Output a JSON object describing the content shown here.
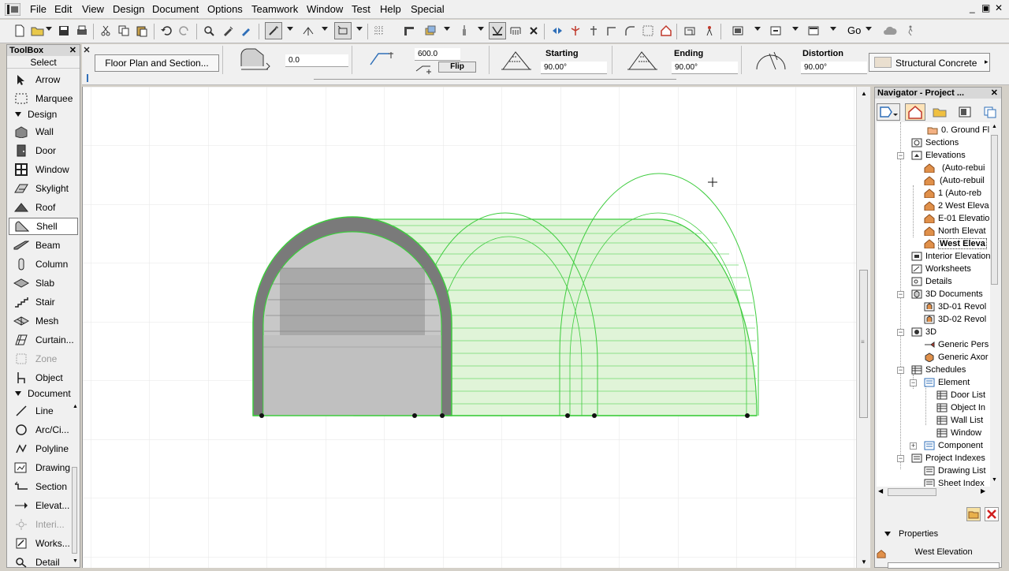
{
  "menubar": {
    "items": [
      "File",
      "Edit",
      "View",
      "Design",
      "Document",
      "Options",
      "Teamwork",
      "Window",
      "Test",
      "Help",
      "Special"
    ],
    "win_controls": [
      "_",
      "▣",
      "✕"
    ]
  },
  "toolbar": {
    "go_label": "Go"
  },
  "infobox": {
    "view_button": "Floor Plan and Section...",
    "offset_value": "0.0",
    "height_value": "600.0",
    "flip_label": "Flip",
    "starting_label": "Starting",
    "starting_value": "90.00°",
    "ending_label": "Ending",
    "ending_value": "90.00°",
    "distortion_label": "Distortion",
    "distortion_value": "90.00°",
    "material": "Structural Concrete"
  },
  "toolbox": {
    "title": "ToolBox",
    "select_header": "Select",
    "select_tools": [
      "Arrow",
      "Marquee"
    ],
    "design_group": "Design",
    "design_tools": [
      "Wall",
      "Door",
      "Window",
      "Skylight",
      "Roof",
      "Shell",
      "Beam",
      "Column",
      "Slab",
      "Stair",
      "Mesh",
      "Curtain...",
      "Zone",
      "Object"
    ],
    "document_group": "Document",
    "document_tools": [
      "Line",
      "Arc/Ci...",
      "Polyline",
      "Drawing",
      "Section",
      "Elevat...",
      "Interi...",
      "Works...",
      "Detail"
    ],
    "selected_tool": "Shell"
  },
  "navigator": {
    "title": "Navigator - Project ...",
    "tree": [
      "0. Ground Fl",
      "Sections",
      "Elevations",
      "(Auto-rebui",
      "(Auto-rebuil",
      "1   (Auto-reb",
      "2 West Eleva",
      "E-01 Elevatio",
      "North Elevat",
      "West Eleva",
      "Interior Elevation",
      "Worksheets",
      "Details",
      "3D Documents",
      "3D-01 Revol",
      "3D-02 Revol",
      "3D",
      "Generic Pers",
      "Generic Axor",
      "Schedules",
      "Element",
      "Door List",
      "Object In",
      "Wall List",
      "Window",
      "Component",
      "Project Indexes",
      "Drawing List",
      "Sheet Index"
    ],
    "properties_label": "Properties",
    "properties_value": "West Elevation"
  }
}
